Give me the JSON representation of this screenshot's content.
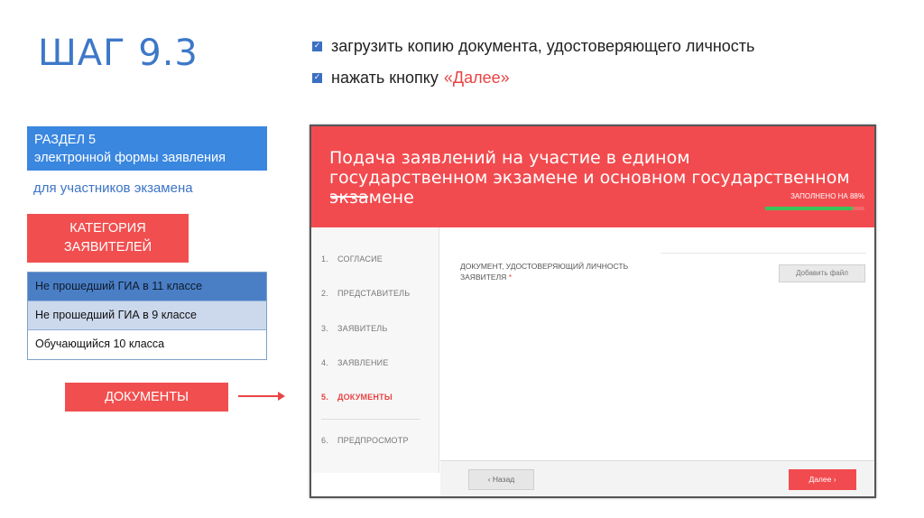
{
  "step_title": "ШАГ 9.3",
  "instructions": [
    {
      "text": "загрузить копию документа, удостоверяющего личность",
      "highlight": ""
    },
    {
      "text": "нажать кнопку",
      "highlight": "«Далее»"
    }
  ],
  "left_panel": {
    "section_line1": "РАЗДЕЛ 5",
    "section_line2": "электронной формы заявления",
    "section_sub": "для участников экзамена",
    "category_line1": "КАТЕГОРИЯ",
    "category_line2": "ЗАЯВИТЕЛЕЙ",
    "categories": [
      "Не прошедший ГИА в 11 классе",
      "Не прошедший ГИА в 9 классе",
      "Обучающийся 10 класса"
    ],
    "documents_label": "ДОКУМЕНТЫ"
  },
  "screen": {
    "title": "Подача заявлений на участие в едином государственном экзамене и основном государственном экзамене",
    "progress_label": "ЗАПОЛНЕНО НА 88%",
    "progress": 0.88,
    "nav": [
      {
        "num": "1.",
        "label": "СОГЛАСИЕ"
      },
      {
        "num": "2.",
        "label": "ПРЕДСТАВИТЕЛЬ"
      },
      {
        "num": "3.",
        "label": "ЗАЯВИТЕЛЬ"
      },
      {
        "num": "4.",
        "label": "ЗАЯВЛЕНИЕ"
      },
      {
        "num": "5.",
        "label": "ДОКУМЕНТЫ"
      },
      {
        "num": "6.",
        "label": "ПРЕДПРОСМОТР"
      }
    ],
    "field_label": "ДОКУМЕНТ, УДОСТОВЕРЯЮЩИЙ ЛИЧНОСТЬ ЗАЯВИТЕЛЯ",
    "required_mark": "*",
    "add_file_button": "Добавить файл",
    "back_button": "‹ Назад",
    "next_button": "Далее ›"
  },
  "colors": {
    "accent_red": "#f24b4f",
    "accent_blue": "#3a87e0",
    "progress_green": "#39c45a"
  }
}
